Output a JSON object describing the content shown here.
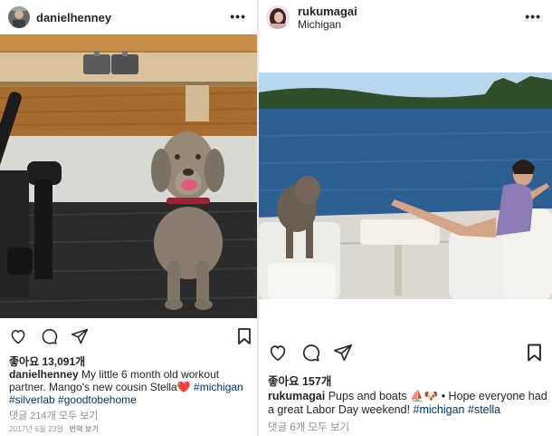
{
  "posts": [
    {
      "username": "danielhenney",
      "location": "",
      "more_label": "•••",
      "likes_text": "좋아요 13,091개",
      "caption_user": "danielhenney",
      "caption_text": "My little 6 month old workout partner. Mango's new cousin Stella",
      "caption_emoji": "❤️",
      "hashtags": [
        "#michigan",
        "#silverlab",
        "#goodtobehome"
      ],
      "comments_text": "댓글 214개 모두 보기",
      "date_text": "2017년 6월 23일",
      "translation_label": "번역 보기"
    },
    {
      "username": "rukumagai",
      "location": "Michigan",
      "more_label": "•••",
      "likes_text": "좋아요 157개",
      "caption_user": "rukumagai",
      "caption_text": "Pups and boats",
      "caption_emoji": "⛵🐶",
      "caption_text_2": "• Hope everyone had a great Labor Day weekend!",
      "hashtags": [
        "#michigan",
        "#stella"
      ],
      "comments_text": "댓글 6개 모두 보기"
    }
  ],
  "icons": [
    "heart-icon",
    "comment-icon",
    "share-icon",
    "bookmark-icon",
    "more-icon"
  ],
  "colors": {
    "text": "#262626",
    "secondary": "#8e8e8e",
    "hashtag": "#003569",
    "divider": "#e6e6e6"
  }
}
